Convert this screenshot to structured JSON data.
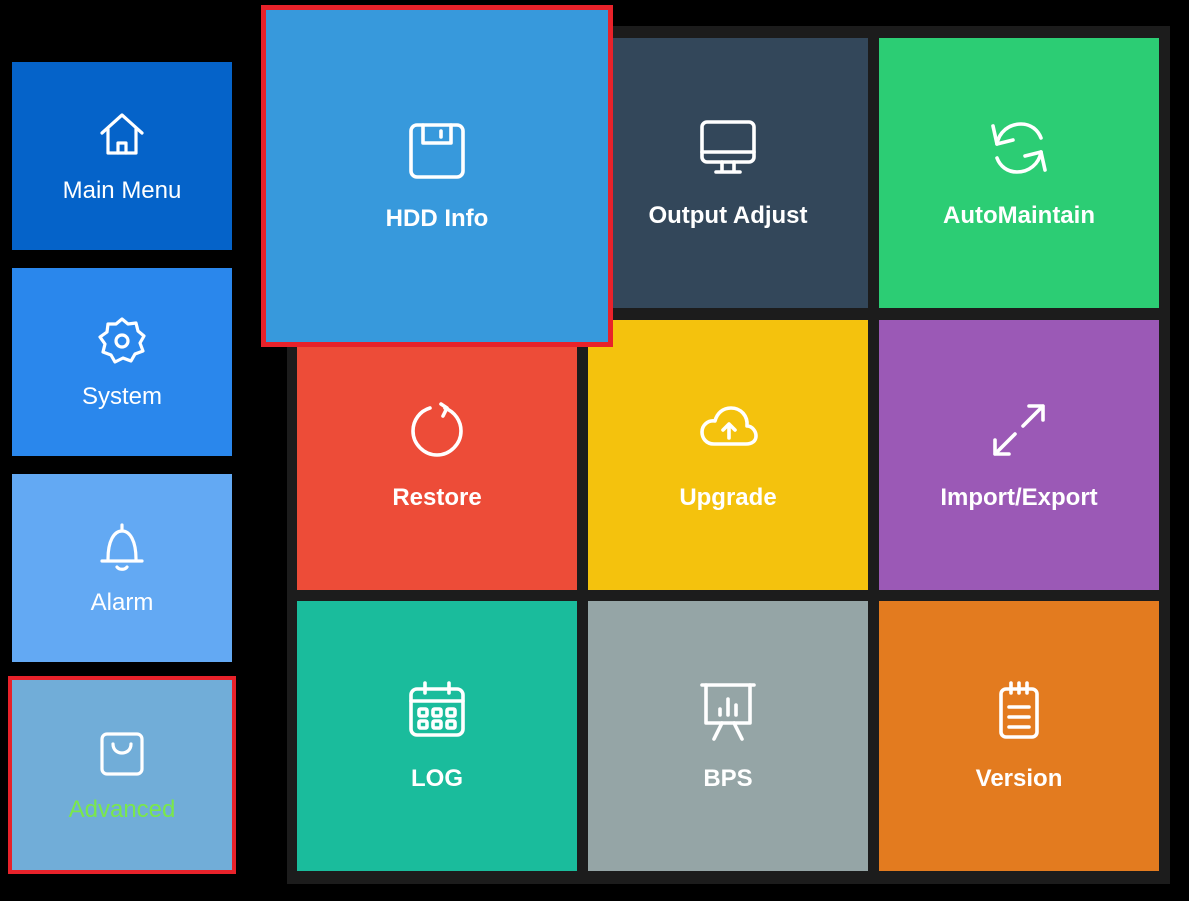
{
  "sidebar": {
    "items": [
      {
        "label": "Main Menu",
        "icon": "home-icon",
        "color": "#0563c9"
      },
      {
        "label": "System",
        "icon": "gear-icon",
        "color": "#2a87ec"
      },
      {
        "label": "Alarm",
        "icon": "bell-icon",
        "color": "#63a9f3"
      },
      {
        "label": "Advanced",
        "icon": "shopping-bag-icon",
        "color": "#71add8",
        "selected": true,
        "label_color": "#7ae84a"
      }
    ]
  },
  "tiles": [
    {
      "label": "HDD Info",
      "icon": "floppy-disk-icon",
      "color": "#3799dc",
      "selected": true
    },
    {
      "label": "Output Adjust",
      "icon": "monitor-icon",
      "color": "#33475a"
    },
    {
      "label": "AutoMaintain",
      "icon": "refresh-icon",
      "color": "#2ccd74"
    },
    {
      "label": "Restore",
      "icon": "restore-icon",
      "color": "#ed4c38"
    },
    {
      "label": "Upgrade",
      "icon": "cloud-upload-icon",
      "color": "#f4c20d"
    },
    {
      "label": "Import/Export",
      "icon": "expand-arrows-icon",
      "color": "#9b59b6"
    },
    {
      "label": "LOG",
      "icon": "calendar-icon",
      "color": "#1abc9c"
    },
    {
      "label": "BPS",
      "icon": "presentation-chart-icon",
      "color": "#95a5a6"
    },
    {
      "label": "Version",
      "icon": "notepad-icon",
      "color": "#e37b1f"
    }
  ]
}
